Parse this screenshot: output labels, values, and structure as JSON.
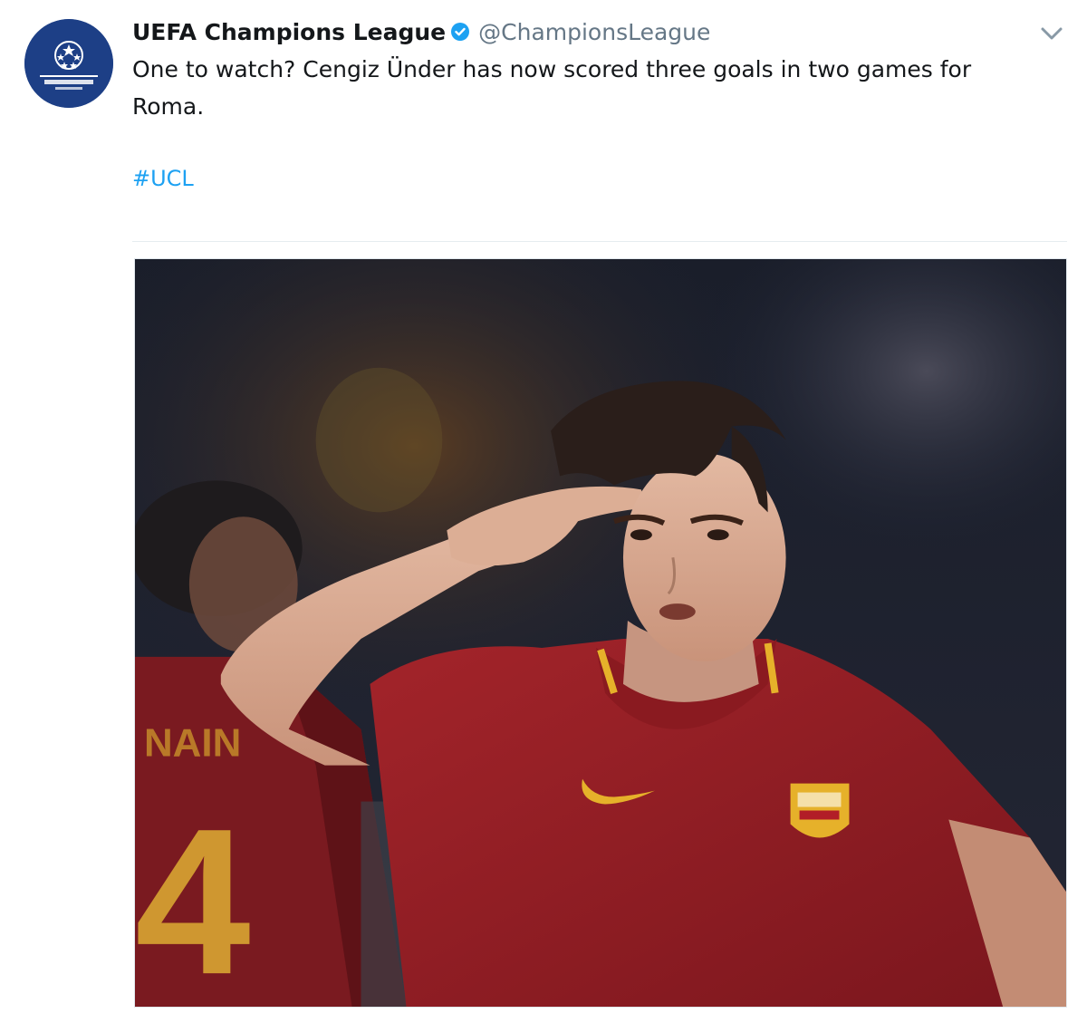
{
  "tweet": {
    "display_name": "UEFA Champions League",
    "handle": "@ChampionsLeague",
    "text": "One to watch? Cengiz Ünder has now scored three goals in two games for Roma.",
    "hashtag": "#UCL",
    "avatar_icon": "champions-league-logo",
    "verified_icon": "verified-badge-icon",
    "menu_icon": "chevron-down-icon"
  },
  "media": {
    "shirt_number": "4"
  },
  "colors": {
    "link": "#1da1f2",
    "verified": "#1da1f2",
    "avatar_bg": "#1d3f86",
    "handle": "#657786"
  }
}
